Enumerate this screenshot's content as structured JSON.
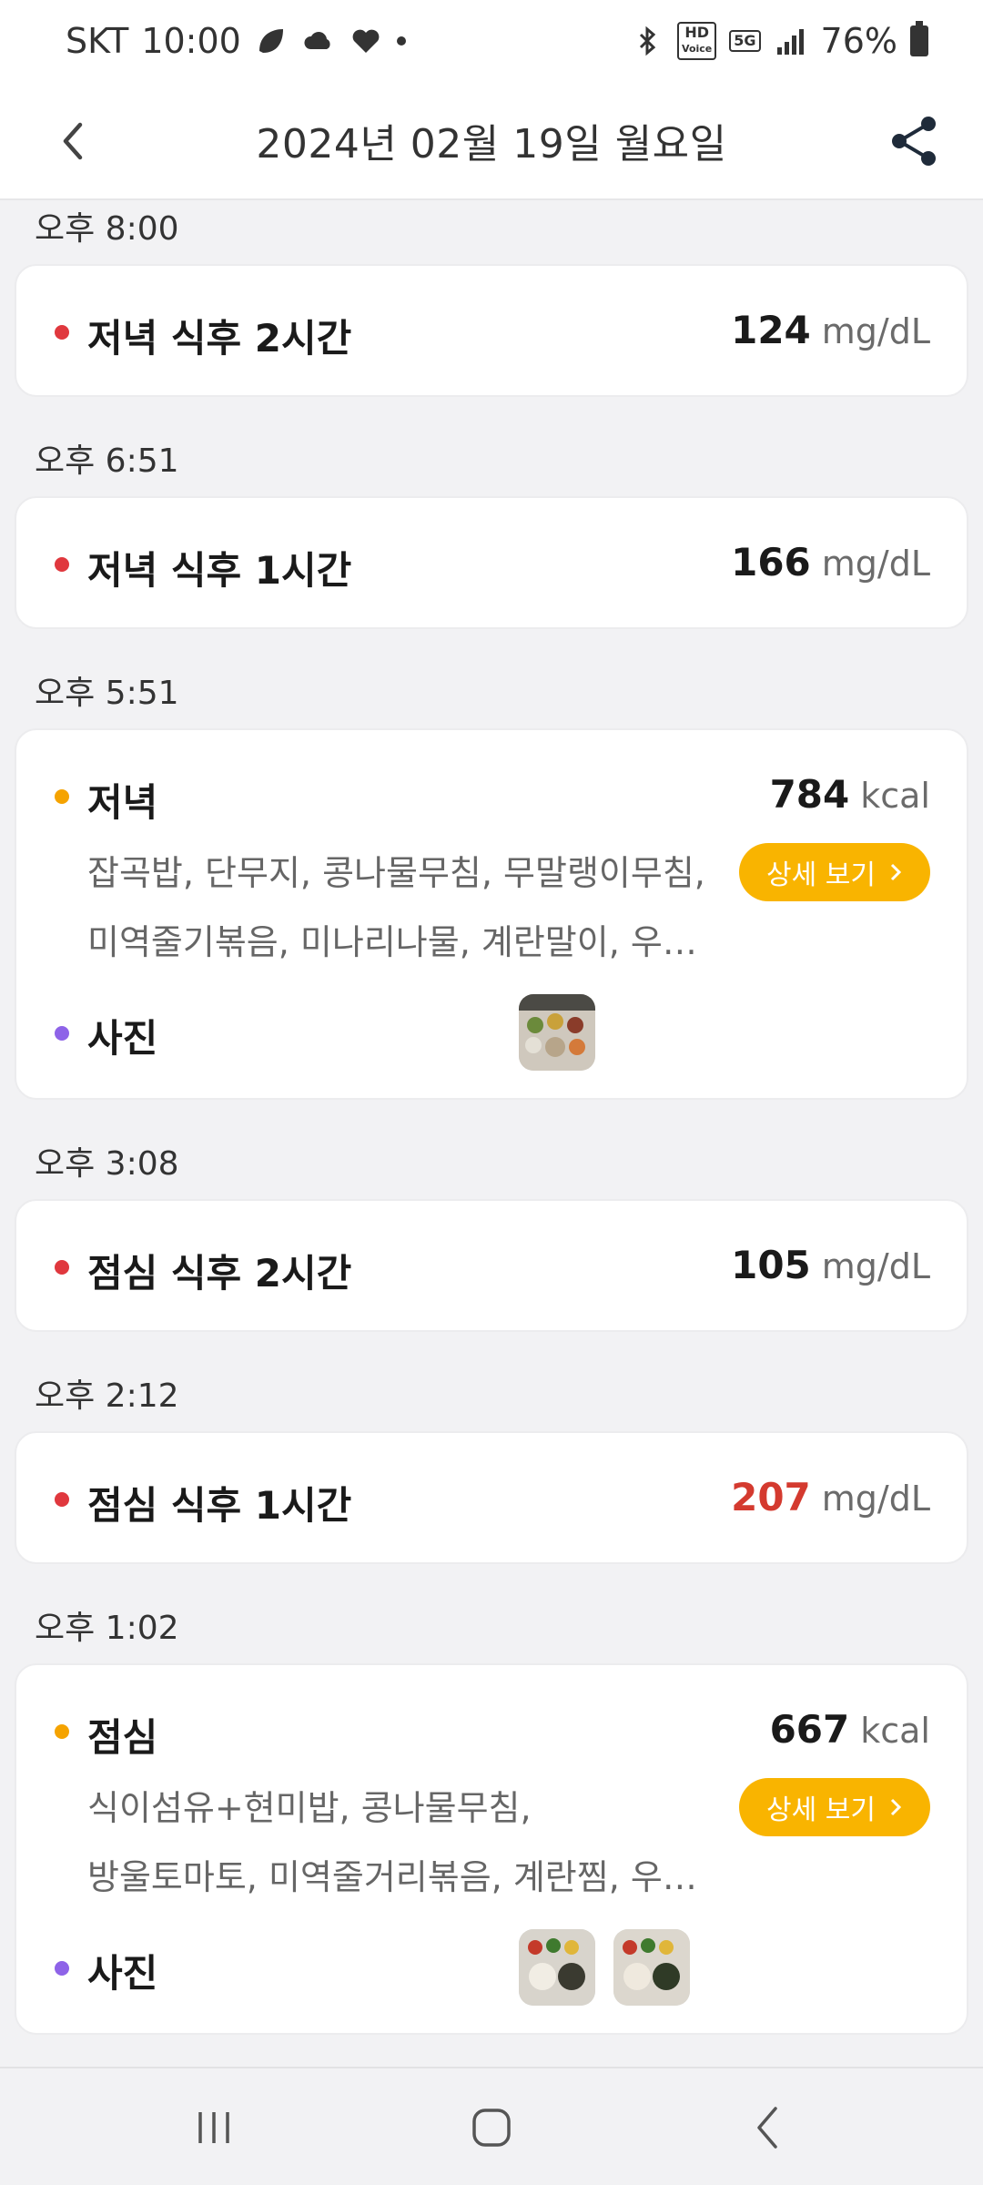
{
  "status_bar": {
    "carrier": "SKT",
    "time": "10:00",
    "hd_label": "HD",
    "voice_label": "Voice",
    "network": "5G",
    "battery": "76%"
  },
  "header": {
    "title": "2024년 02월 19일 월요일"
  },
  "entries": [
    {
      "time": "오후 8:00",
      "type": "glucose",
      "label": "저녁 식후 2시간",
      "value": "124",
      "unit": "mg/dL"
    },
    {
      "time": "오후 6:51",
      "type": "glucose",
      "label": "저녁 식후 1시간",
      "value": "166",
      "unit": "mg/dL"
    },
    {
      "time": "오후 5:51",
      "type": "meal",
      "label": "저녁",
      "value": "784",
      "unit": "kcal",
      "foods_line1": "잡곡밥, 단무지, 콩나물무침, 무말랭이무침,",
      "foods_line2": "미역줄기볶음, 미나리나물, 계란말이, 우…",
      "detail_label": "상세 보기",
      "photo_label": "사진",
      "photo_count": 1
    },
    {
      "time": "오후 3:08",
      "type": "glucose",
      "label": "점심 식후 2시간",
      "value": "105",
      "unit": "mg/dL"
    },
    {
      "time": "오후 2:12",
      "type": "glucose",
      "label": "점심 식후 1시간",
      "value": "207",
      "unit": "mg/dL",
      "high": true
    },
    {
      "time": "오후 1:02",
      "type": "meal",
      "label": "점심",
      "value": "667",
      "unit": "kcal",
      "foods_line1": "식이섬유+현미밥, 콩나물무침,",
      "foods_line2": "방울토마토, 미역줄거리볶음, 계란찜, 우…",
      "detail_label": "상세 보기",
      "photo_label": "사진",
      "photo_count": 2
    }
  ],
  "colors": {
    "glucose_dot": "#e0383e",
    "meal_dot": "#f5a300",
    "photo_dot": "#8e63e8",
    "detail_button": "#f9b400",
    "high_value": "#d43a2f"
  }
}
